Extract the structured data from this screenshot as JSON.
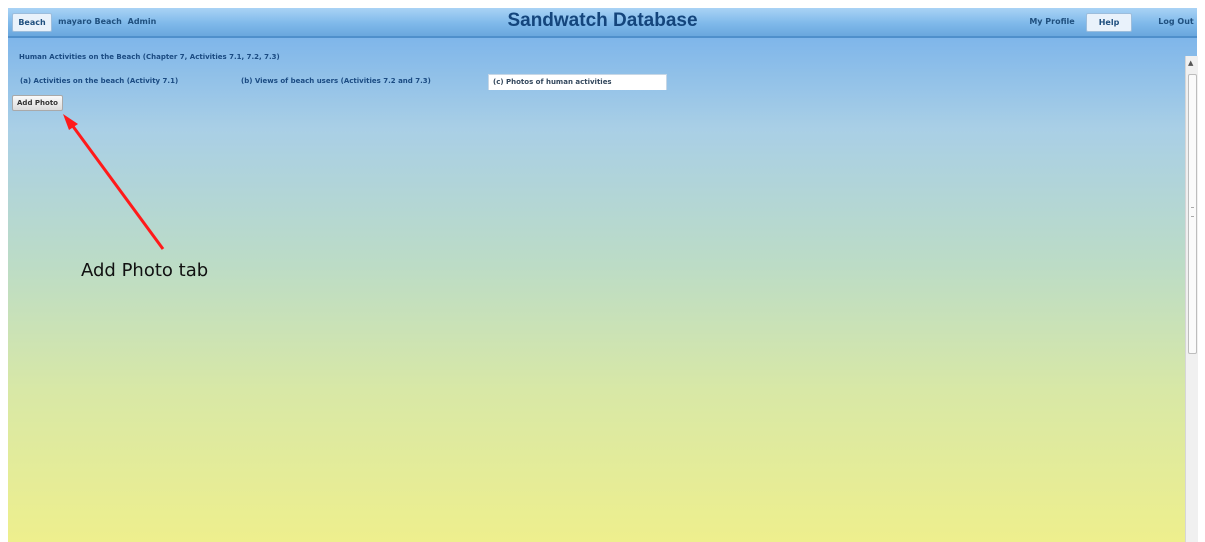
{
  "topbar": {
    "nav_left": [
      "Beach",
      "mayaro Beach",
      "Admin"
    ],
    "title": "Sandwatch Database",
    "nav_right": [
      "My Profile",
      "Help",
      "Log Out"
    ]
  },
  "section": {
    "title": "Human Activities on the Beach (Chapter 7, Activities 7.1, 7.2, 7.3)"
  },
  "tabs": [
    {
      "label": "(a) Activities on the beach (Activity 7.1)",
      "active": false
    },
    {
      "label": "(b) Views of beach users (Activities 7.2 and 7.3)",
      "active": false
    },
    {
      "label": "(c) Photos of human activities",
      "active": true
    }
  ],
  "add_photo_label": "Add Photo",
  "annotation": {
    "label": "Add Photo tab",
    "arrow_color": "#ff1a1a"
  },
  "colors": {
    "topbar": "#7fb9ea",
    "title": "#14457c",
    "gradient_top": "#7fb6ea",
    "gradient_bottom": "#eeef8d"
  }
}
